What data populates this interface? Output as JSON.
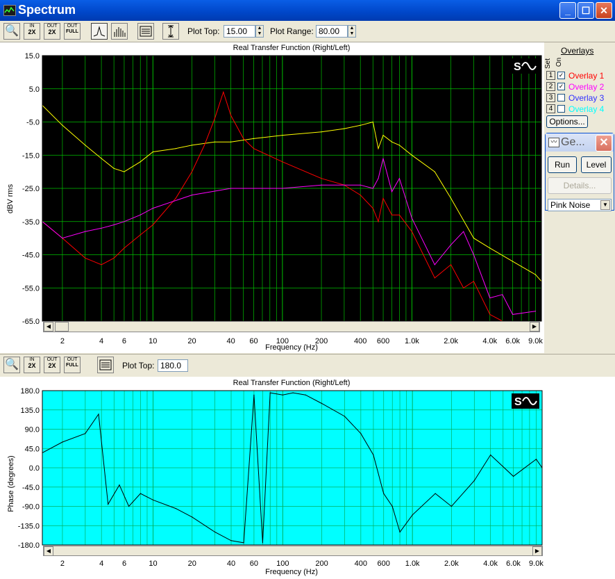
{
  "window": {
    "title": "Spectrum",
    "icon": "spectrum-app-icon",
    "controls": [
      "minimize-icon",
      "maximize-icon",
      "close-icon"
    ]
  },
  "top_toolbar": {
    "buttons": [
      {
        "name": "zoom-button",
        "icon": "magnifier-icon",
        "label": ""
      },
      {
        "name": "zoom-in-2x-button",
        "icon": "zoom-in-2x-icon",
        "label": "IN 2X"
      },
      {
        "name": "zoom-out-2x-button",
        "icon": "zoom-out-2x-icon",
        "label": "OUT 2X"
      },
      {
        "name": "zoom-out-full-button",
        "icon": "zoom-out-full-icon",
        "label": "OUT FULL"
      },
      {
        "name": "line-mode-button",
        "icon": "line-graph-icon",
        "label": ""
      },
      {
        "name": "bar-mode-button",
        "icon": "bar-graph-icon",
        "label": ""
      },
      {
        "name": "legend-button",
        "icon": "legend-icon",
        "label": ""
      },
      {
        "name": "autoscale-button",
        "icon": "vertical-scale-icon",
        "label": ""
      }
    ],
    "plot_top_label": "Plot Top:",
    "plot_top_value": "15.00",
    "plot_range_label": "Plot Range:",
    "plot_range_value": "80.00"
  },
  "top_chart": {
    "title": "Real Transfer Function (Right/Left)",
    "ylabel": "dBV rms",
    "xlabel": "Frequency (Hz)",
    "yticks": [
      "15.0",
      "5.0",
      "-5.0",
      "-15.0",
      "-25.0",
      "-35.0",
      "-45.0",
      "-55.0",
      "-65.0"
    ],
    "xticks": [
      "2",
      "4",
      "6",
      "10",
      "20",
      "40",
      "60",
      "100",
      "200",
      "400",
      "600",
      "1.0k",
      "2.0k",
      "4.0k",
      "6.0k",
      "9.0k"
    ],
    "colors": {
      "background": "#000000",
      "grid": "#00c000"
    }
  },
  "overlays": {
    "title": "Overlays",
    "col_set": "Set",
    "col_on": "On",
    "items": [
      {
        "num": "1",
        "checked": "✓",
        "label": "Overlay 1",
        "color": "#ff0000"
      },
      {
        "num": "2",
        "checked": "✓",
        "label": "Overlay 2",
        "color": "#ff00ff"
      },
      {
        "num": "3",
        "checked": "",
        "label": "Overlay 3",
        "color": "#3030ff"
      },
      {
        "num": "4",
        "checked": "",
        "label": "Overlay 4",
        "color": "#00ffff"
      }
    ],
    "options_label": "Options..."
  },
  "generator": {
    "title": "Ge...",
    "run_label": "Run",
    "level_label": "Level",
    "details_label": "Details...",
    "signal_value": "Pink Noise"
  },
  "bottom_toolbar": {
    "plot_top_label": "Plot Top:",
    "plot_top_value": "180.0"
  },
  "bottom_chart": {
    "title": "Real Transfer Function (Right/Left)",
    "ylabel": "Phase (degrees)",
    "xlabel": "Frequency (Hz)",
    "yticks": [
      "180.0",
      "135.0",
      "90.0",
      "45.0",
      "0.0",
      "-45.0",
      "-90.0",
      "-135.0",
      "-180.0"
    ],
    "xticks": [
      "2",
      "4",
      "6",
      "10",
      "20",
      "40",
      "60",
      "100",
      "200",
      "400",
      "600",
      "1.0k",
      "2.0k",
      "4.0k",
      "6.0k",
      "9.0k"
    ],
    "colors": {
      "background": "#00ffff",
      "grid": "#00b060",
      "trace": "#000000"
    }
  },
  "chart_data": [
    {
      "type": "line",
      "title": "Real Transfer Function (Right/Left)",
      "xlabel": "Frequency (Hz)",
      "ylabel": "dBV rms",
      "x_scale": "log",
      "xlim": [
        1.4,
        10000
      ],
      "ylim": [
        -65,
        15
      ],
      "grid": true,
      "series": [
        {
          "color": "#ffff00",
          "x": [
            1.4,
            2,
            3,
            4,
            5,
            6,
            8,
            10,
            15,
            20,
            30,
            40,
            60,
            100,
            200,
            300,
            400,
            500,
            550,
            600,
            700,
            800,
            1000,
            1500,
            2000,
            3000,
            4000,
            6000,
            9000,
            10000
          ],
          "y": [
            0,
            -6,
            -12,
            -16,
            -19,
            -20,
            -17,
            -14,
            -13,
            -12,
            -11,
            -11,
            -10,
            -9,
            -8,
            -7,
            -6,
            -5,
            -13,
            -9,
            -11,
            -12,
            -15,
            -20,
            -28,
            -40,
            -43,
            -47,
            -51,
            -53
          ]
        },
        {
          "color": "#ff0000",
          "x": [
            1.4,
            2,
            3,
            4,
            5,
            6,
            8,
            10,
            15,
            20,
            25,
            30,
            35,
            40,
            50,
            60,
            100,
            200,
            300,
            400,
            500,
            550,
            600,
            700,
            800,
            1000,
            1500,
            2000,
            2500,
            3000,
            4000,
            5000,
            6000
          ],
          "y": [
            -35,
            -40,
            -46,
            -48,
            -46,
            -43,
            -39,
            -36,
            -28,
            -20,
            -12,
            -4,
            4,
            -3,
            -10,
            -13,
            -17,
            -22,
            -24,
            -27,
            -31,
            -35,
            -28,
            -33,
            -33,
            -38,
            -52,
            -48,
            -55,
            -53,
            -63,
            -65,
            -65
          ]
        },
        {
          "color": "#ff00ff",
          "x": [
            1.4,
            2,
            3,
            4,
            5,
            6,
            8,
            10,
            20,
            40,
            100,
            200,
            400,
            500,
            550,
            600,
            700,
            800,
            1000,
            1500,
            2000,
            2500,
            3000,
            4000,
            5000,
            6000,
            9000
          ],
          "y": [
            -35,
            -40,
            -38,
            -37,
            -36,
            -35,
            -33,
            -31,
            -27,
            -25,
            -25,
            -24,
            -24,
            -25,
            -22,
            -16,
            -26,
            -22,
            -34,
            -48,
            -42,
            -38,
            -45,
            -58,
            -57,
            -63,
            -62
          ]
        }
      ]
    },
    {
      "type": "line",
      "title": "Real Transfer Function (Right/Left)",
      "xlabel": "Frequency (Hz)",
      "ylabel": "Phase (degrees)",
      "x_scale": "log",
      "xlim": [
        1.4,
        10000
      ],
      "ylim": [
        -180,
        180
      ],
      "grid": true,
      "series": [
        {
          "color": "#000000",
          "x": [
            1.4,
            2,
            3,
            3.8,
            4.5,
            5.5,
            6.5,
            8,
            10,
            15,
            20,
            30,
            40,
            50,
            60,
            70,
            80,
            100,
            120,
            150,
            200,
            300,
            400,
            500,
            600,
            700,
            800,
            1000,
            1500,
            2000,
            3000,
            4000,
            6000,
            9000,
            10000
          ],
          "y": [
            35,
            60,
            80,
            125,
            -85,
            -40,
            -90,
            -60,
            -75,
            -95,
            -115,
            -150,
            -170,
            -175,
            170,
            -175,
            175,
            170,
            175,
            170,
            150,
            120,
            80,
            30,
            -60,
            -90,
            -150,
            -110,
            -60,
            -90,
            -30,
            30,
            -20,
            20,
            0
          ]
        }
      ]
    }
  ]
}
